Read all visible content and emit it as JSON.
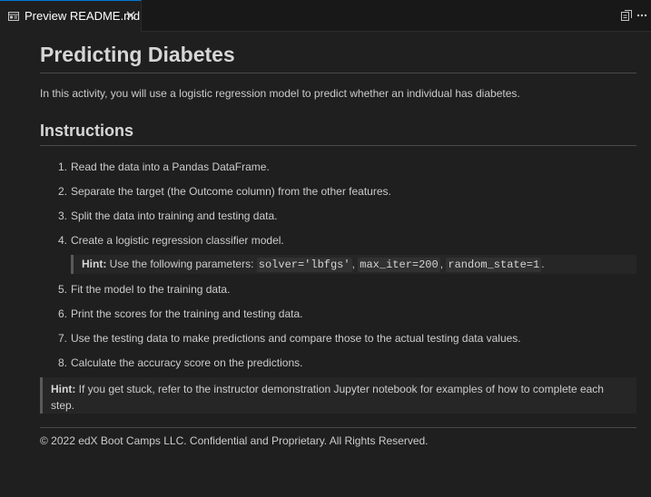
{
  "tab": {
    "title": "Preview README.md",
    "icon": "preview-icon",
    "close_icon": "close-icon"
  },
  "actions": [
    "open-source-icon",
    "more-actions-icon"
  ],
  "doc": {
    "title": "Predicting Diabetes",
    "intro": "In this activity, you will use a logistic regression model to predict whether an individual has diabetes.",
    "instructions_heading": "Instructions",
    "steps": [
      {
        "num": "1.",
        "text": "Read the data into a Pandas DataFrame."
      },
      {
        "num": "2.",
        "text": "Separate the target (the Outcome column) from the other features."
      },
      {
        "num": "3.",
        "text": "Split the data into training and testing data."
      },
      {
        "num": "4.",
        "text": "Create a logistic regression classifier model."
      },
      {
        "num": "5.",
        "text": "Fit the model to the training data."
      },
      {
        "num": "6.",
        "text": "Print the scores for the training and testing data."
      },
      {
        "num": "7.",
        "text": "Use the testing data to make predictions and compare those to the actual testing data values."
      },
      {
        "num": "8.",
        "text": "Calculate the accuracy score on the predictions."
      }
    ],
    "inner_hint": {
      "label": "Hint:",
      "text": "Use the following parameters:",
      "code1": "solver='lbfgs'",
      "code2": "max_iter=200",
      "code3": "random_state=1",
      "sep": ",",
      "end": "."
    },
    "outer_hint": {
      "label": "Hint:",
      "text": "If you get stuck, refer to the instructor demonstration Jupyter notebook for examples of how to complete each step."
    },
    "footer": "© 2022 edX Boot Camps LLC. Confidential and Proprietary. All Rights Reserved."
  },
  "colors": {
    "accent": "#0078d4",
    "background": "#1f1f1f",
    "text": "#cccccc"
  }
}
